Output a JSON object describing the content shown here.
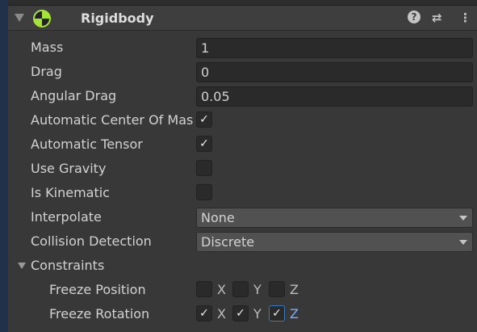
{
  "component": {
    "title": "Rigidbody",
    "icons": [
      "fold-arrow-icon",
      "rigidbody-icon",
      "help-icon",
      "presets-icon",
      "more-icon"
    ]
  },
  "fields": [
    {
      "label": "Mass",
      "value": "1"
    },
    {
      "label": "Drag",
      "value": "0"
    },
    {
      "label": "Angular Drag",
      "value": "0.05"
    }
  ],
  "toggles": [
    {
      "label": "Automatic Center Of Mass",
      "checked": true,
      "mark": "✓"
    },
    {
      "label": "Automatic Tensor",
      "checked": true,
      "mark": "✓"
    },
    {
      "label": "Use Gravity",
      "checked": false,
      "mark": ""
    },
    {
      "label": "Is Kinematic",
      "checked": false,
      "mark": ""
    }
  ],
  "dropdowns": [
    {
      "label": "Interpolate",
      "value": "None"
    },
    {
      "label": "Collision Detection",
      "value": "Discrete"
    }
  ],
  "constraints": {
    "label": "Constraints",
    "freeze_position": {
      "label": "Freeze Position",
      "x": "X",
      "y": "Y",
      "z": "Z",
      "checks": [
        "",
        "",
        ""
      ]
    },
    "freeze_rotation": {
      "label": "Freeze Rotation",
      "x": "X",
      "y": "Y",
      "z": "Z",
      "checks": [
        "✓",
        "✓",
        "✓"
      ]
    }
  },
  "colors": {
    "accent": "#a6e23a",
    "focus": "#3a79bb",
    "focus_text": "#7aaeff"
  }
}
